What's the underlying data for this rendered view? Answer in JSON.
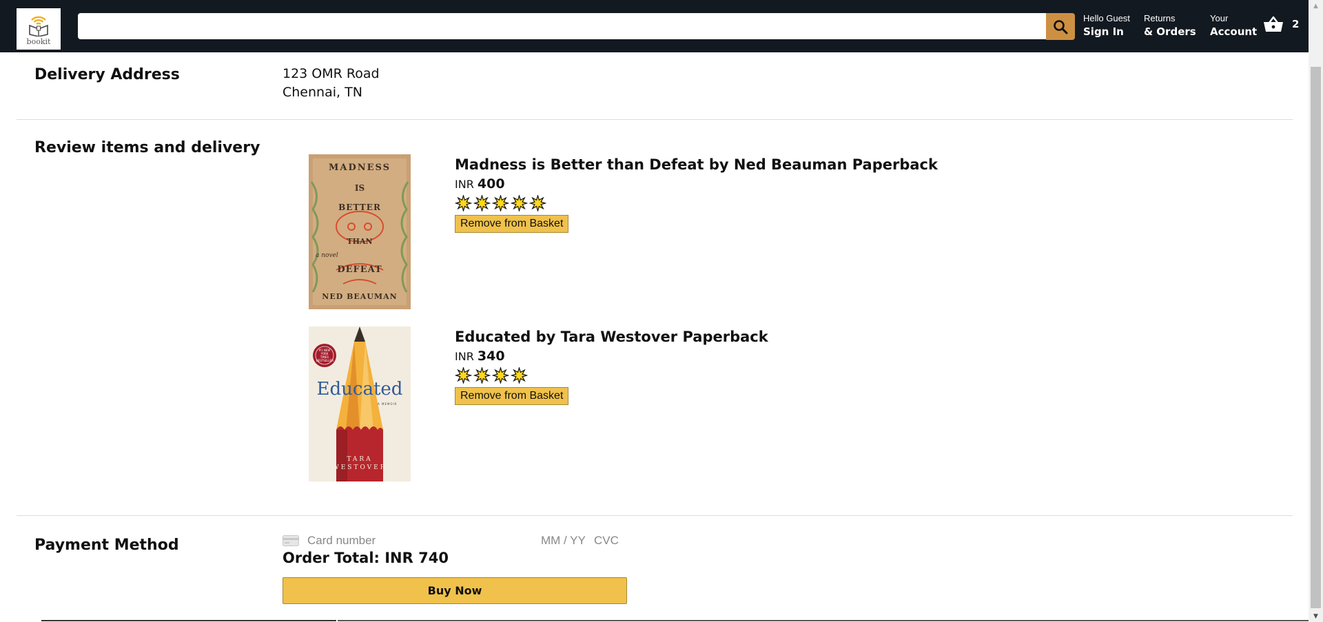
{
  "header": {
    "logo_text": "bookit",
    "search": {
      "value": "",
      "placeholder": ""
    },
    "nav": [
      {
        "top": "Hello Guest",
        "bottom": "Sign In"
      },
      {
        "top": "Returns",
        "bottom": "& Orders"
      },
      {
        "top": "Your",
        "bottom": "Account"
      }
    ],
    "basket_count": "2",
    "colors": {
      "background": "#131921",
      "search_button": "#cd9042"
    }
  },
  "delivery": {
    "title": "Delivery Address",
    "line1": "123 OMR Road",
    "line2": "Chennai, TN"
  },
  "review": {
    "title": "Review items and delivery",
    "items": [
      {
        "title": "Madness is Better than Defeat by Ned Beauman Paperback",
        "currency": "INR",
        "price": "400",
        "rating": 5,
        "remove_label": "Remove from Basket",
        "cover": {
          "lines": [
            "MADNESS",
            "IS",
            "BETTER",
            "THAN",
            "DEFEAT"
          ],
          "subtitle": "a novel",
          "author": "NED BEAUMAN",
          "bg": "#c9a074",
          "ink": "#d84d2e"
        }
      },
      {
        "title": "Educated by Tara Westover Paperback",
        "currency": "INR",
        "price": "340",
        "rating": 4,
        "remove_label": "Remove from Basket",
        "cover": {
          "title": "Educated",
          "subtitle": "A MEMOIR",
          "author_line1": "TARA",
          "author_line2": "WESTOVER",
          "badge": "#1 NEW YORK TIMES BESTSELLER",
          "bg": "#f2ece0",
          "title_color": "#2f5b9a"
        }
      }
    ]
  },
  "payment": {
    "title": "Payment Method",
    "card_placeholder": "Card number",
    "expiry_placeholder": "MM / YY",
    "cvc_placeholder": "CVC",
    "order_total": "Order Total: INR 740",
    "buy_label": "Buy Now",
    "button_color": "#f0c14b"
  }
}
